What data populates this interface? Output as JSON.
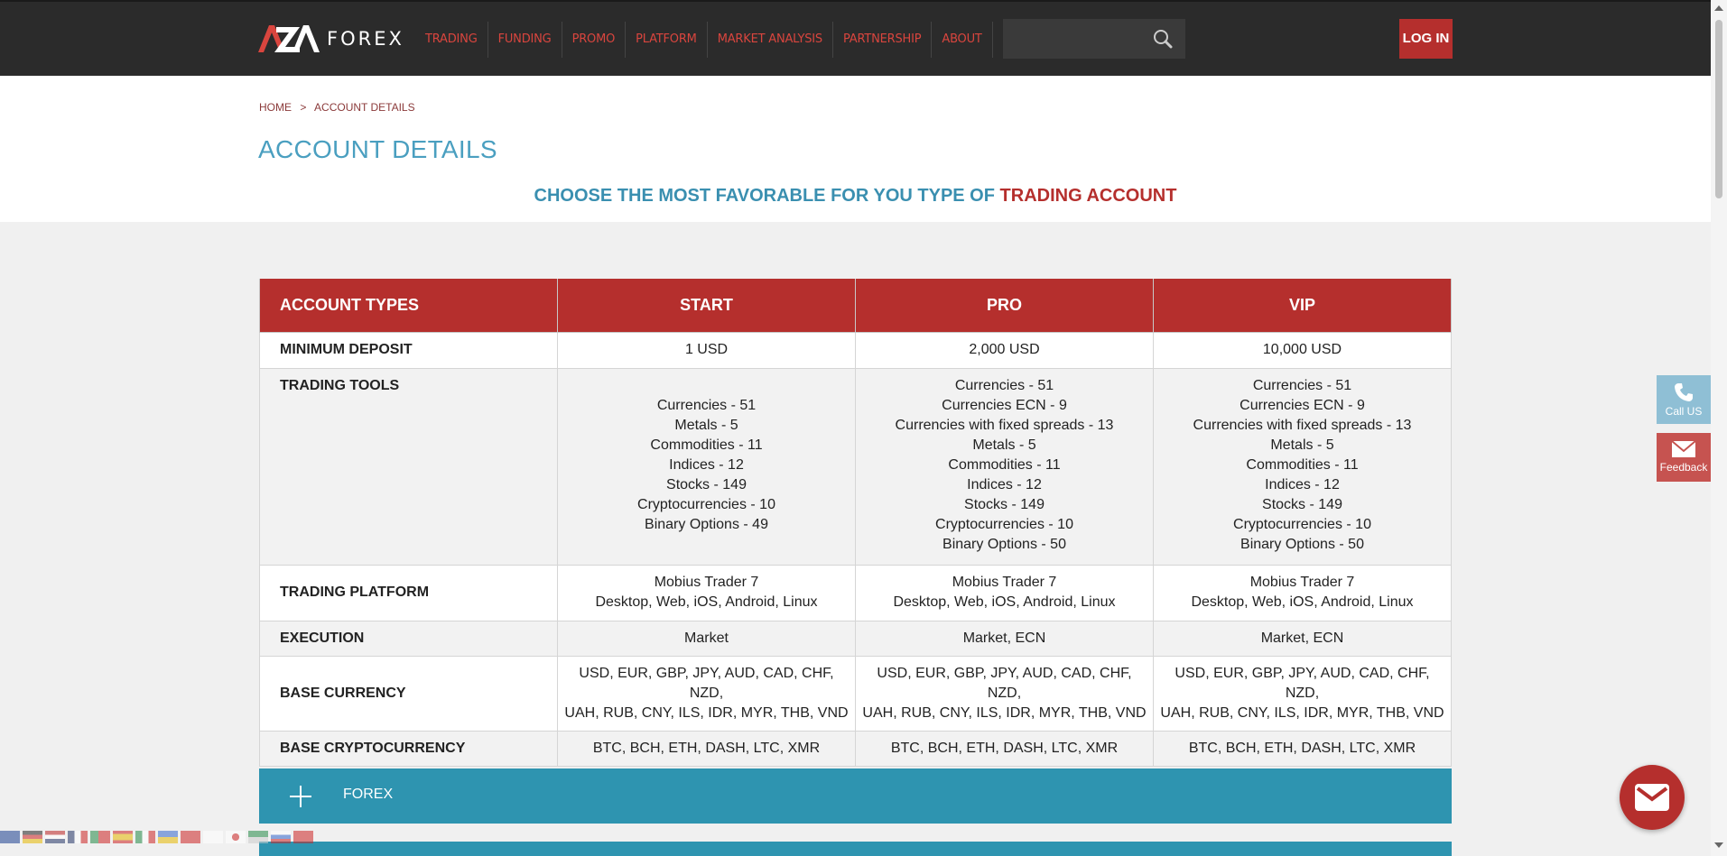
{
  "header": {
    "logo_text": "FOREX",
    "nav": [
      "TRADING",
      "FUNDING",
      "PROMO",
      "PLATFORM",
      "MARKET ANALYSIS",
      "PARTNERSHIP",
      "ABOUT"
    ],
    "search_placeholder": "",
    "login_label": "LOG IN"
  },
  "breadcrumb": {
    "home": "HOME",
    "separator": ">",
    "current": "ACCOUNT DETAILS"
  },
  "page_title": "ACCOUNT DETAILS",
  "subtitle": {
    "main": "CHOOSE THE MOST FAVORABLE FOR YOU TYPE OF",
    "accent": "TRADING ACCOUNT"
  },
  "table": {
    "headers": [
      "ACCOUNT TYPES",
      "START",
      "PRO",
      "VIP"
    ],
    "rows": {
      "min_deposit": {
        "label": "MINIMUM DEPOSIT",
        "values": [
          "1 USD",
          "2,000 USD",
          "10,000 USD"
        ]
      },
      "tools": {
        "label": "TRADING TOOLS",
        "start": [
          "Currencies - 51",
          "Metals - 5",
          "Commodities - 11",
          "Indices - 12",
          "Stocks - 149",
          "Cryptocurrencies - 10",
          "Binary Options - 49"
        ],
        "pro": [
          "Currencies - 51",
          "Currencies ECN - 9",
          "Currencies with fixed spreads - 13",
          "Metals - 5",
          "Commodities - 11",
          "Indices - 12",
          "Stocks - 149",
          "Cryptocurrencies - 10",
          "Binary Options - 50"
        ],
        "vip": [
          "Currencies - 51",
          "Currencies ECN - 9",
          "Currencies with fixed spreads - 13",
          "Metals - 5",
          "Commodities - 11",
          "Indices - 12",
          "Stocks - 149",
          "Cryptocurrencies - 10",
          "Binary Options - 50"
        ]
      },
      "platform": {
        "label": "TRADING PLATFORM",
        "line1": "Mobius Trader 7",
        "line2": "Desktop, Web, iOS, Android, Linux"
      },
      "execution": {
        "label": "EXECUTION",
        "values": [
          "Market",
          "Market, ECN",
          "Market, ECN"
        ]
      },
      "base_currency": {
        "label": "BASE CURRENCY",
        "line1": "USD, EUR, GBP, JPY, AUD, CAD, CHF, NZD,",
        "line2": "UAH, RUB, CNY, ILS, IDR, MYR, THB, VND"
      },
      "base_crypto": {
        "label": "BASE CRYPTOCURRENCY",
        "value": "BTC, BCH, ETH, DASH, LTC, XMR"
      }
    }
  },
  "accordion": {
    "label": "FOREX"
  },
  "side": {
    "call": "Call US",
    "feedback": "Feedback"
  },
  "colors": {
    "brand_red": "#b52f2d",
    "accent_blue": "#2e94b0",
    "header_bg": "#2b2b2b"
  }
}
